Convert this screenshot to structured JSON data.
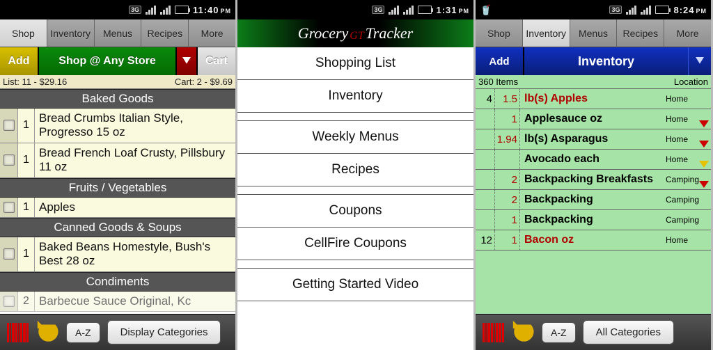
{
  "status": {
    "time1": "11:40",
    "ampm1": "PM",
    "time2": "1:31",
    "ampm2": "PM",
    "time3": "8:24",
    "ampm3": "PM",
    "threeg": "3G"
  },
  "tabs": {
    "shop": "Shop",
    "inventory": "Inventory",
    "menus": "Menus",
    "recipes": "Recipes",
    "more": "More"
  },
  "phone1": {
    "add": "Add",
    "store": "Shop @ Any Store",
    "cart": "Cart",
    "list_info": "List: 11 - $29.16",
    "cart_info": "Cart: 2 - $9.69",
    "cats": {
      "baked": "Baked Goods",
      "fruits": "Fruits / Vegetables",
      "canned": "Canned Goods & Soups",
      "cond": "Condiments"
    },
    "items": {
      "bread_crumbs_q": "1",
      "bread_crumbs": "Bread Crumbs Italian Style, Progresso 15 oz",
      "bread_french_q": "1",
      "bread_french": "Bread French Loaf Crusty, Pillsbury 11 oz",
      "apples_q": "1",
      "apples": "Apples",
      "beans_q": "1",
      "beans": "Baked Beans Homestyle, Bush's Best 28 oz",
      "bbq_q": "2",
      "bbq": "Barbecue Sauce Original, Kc"
    },
    "az": "A-Z",
    "disp_cat": "Display Categories"
  },
  "phone2": {
    "title_left": "Grocery",
    "title_gt": "GT",
    "title_right": "Tracker",
    "menu": {
      "shopping": "Shopping List",
      "inventory": "Inventory",
      "weekly": "Weekly Menus",
      "recipes": "Recipes",
      "coupons": "Coupons",
      "cellfire": "CellFire Coupons",
      "getting": "Getting Started Video"
    }
  },
  "phone3": {
    "add": "Add",
    "inventory": "Inventory",
    "items_count": "360 Items",
    "location_hdr": "Location",
    "rows": [
      {
        "c1": "4",
        "c2": "1.5",
        "name": "lb(s) Apples",
        "loc": "Home",
        "red": true,
        "tri": ""
      },
      {
        "c1": "",
        "c2": "1",
        "name": "Applesauce  oz",
        "loc": "Home",
        "tri": "r"
      },
      {
        "c1": "",
        "c2": "1.94",
        "name": "lb(s) Asparagus",
        "loc": "Home",
        "tri": "r"
      },
      {
        "c1": "",
        "c2": "",
        "name": "Avocado  each",
        "loc": "Home",
        "tri": "y"
      },
      {
        "c1": "",
        "c2": "2",
        "name": "Backpacking Breakfasts",
        "loc": "Camping",
        "tri": "r"
      },
      {
        "c1": "",
        "c2": "2",
        "name": "Backpacking",
        "loc": "Camping",
        "tri": ""
      },
      {
        "c1": "",
        "c2": "1",
        "name": "Backpacking",
        "loc": "Camping",
        "tri": ""
      },
      {
        "c1": "12",
        "c2": "1",
        "name": "Bacon  oz",
        "loc": "Home",
        "red": true,
        "tri": ""
      }
    ],
    "az": "A-Z",
    "all_cat": "All Categories"
  }
}
